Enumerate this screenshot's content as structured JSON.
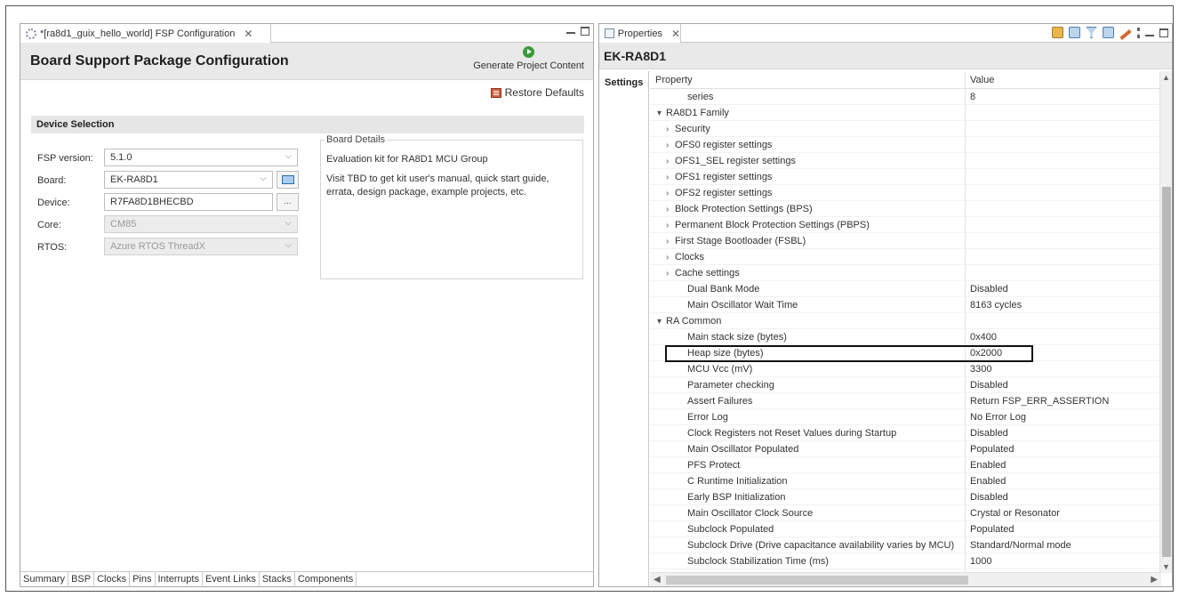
{
  "editor": {
    "tab_title": "*[ra8d1_guix_hello_world] FSP Configuration",
    "tab_close": "✕",
    "header_title": "Board Support Package Configuration",
    "generate_label": "Generate Project Content",
    "restore_label": "Restore Defaults",
    "section_title": "Device Selection",
    "fields": {
      "fsp_version_label": "FSP version:",
      "fsp_version_value": "5.1.0",
      "board_label": "Board:",
      "board_value": "EK-RA8D1",
      "device_label": "Device:",
      "device_value": "R7FA8D1BHECBD",
      "device_browse": "...",
      "core_label": "Core:",
      "core_value": "CM85",
      "rtos_label": "RTOS:",
      "rtos_value": "Azure RTOS ThreadX"
    },
    "board_details": {
      "title": "Board Details",
      "line1": "Evaluation kit for RA8D1 MCU Group",
      "line2": "Visit TBD to get kit user's manual, quick start guide,",
      "line3": "errata, design package, example projects, etc."
    },
    "bottom_tabs": [
      "Summary",
      "BSP",
      "Clocks",
      "Pins",
      "Interrupts",
      "Event Links",
      "Stacks",
      "Components"
    ]
  },
  "properties": {
    "tab_title": "Properties",
    "tab_close": "✕",
    "header_title": "EK-RA8D1",
    "side_tab": "Settings",
    "col_property": "Property",
    "col_value": "Value",
    "rows": [
      {
        "p": "series",
        "v": "8",
        "indent": 2,
        "twisty": ""
      },
      {
        "p": "RA8D1 Family",
        "v": "",
        "indent": 0,
        "twisty": "▾"
      },
      {
        "p": "Security",
        "v": "",
        "indent": 1,
        "twisty": "›"
      },
      {
        "p": "OFS0 register settings",
        "v": "",
        "indent": 1,
        "twisty": "›"
      },
      {
        "p": "OFS1_SEL register settings",
        "v": "",
        "indent": 1,
        "twisty": "›"
      },
      {
        "p": "OFS1 register settings",
        "v": "",
        "indent": 1,
        "twisty": "›"
      },
      {
        "p": "OFS2 register settings",
        "v": "",
        "indent": 1,
        "twisty": "›"
      },
      {
        "p": "Block Protection Settings (BPS)",
        "v": "",
        "indent": 1,
        "twisty": "›"
      },
      {
        "p": "Permanent Block Protection Settings (PBPS)",
        "v": "",
        "indent": 1,
        "twisty": "›"
      },
      {
        "p": "First Stage Bootloader (FSBL)",
        "v": "",
        "indent": 1,
        "twisty": "›"
      },
      {
        "p": "Clocks",
        "v": "",
        "indent": 1,
        "twisty": "›"
      },
      {
        "p": "Cache settings",
        "v": "",
        "indent": 1,
        "twisty": "›"
      },
      {
        "p": "Dual Bank Mode",
        "v": "Disabled",
        "indent": 2,
        "twisty": ""
      },
      {
        "p": "Main Oscillator Wait Time",
        "v": "8163 cycles",
        "indent": 2,
        "twisty": ""
      },
      {
        "p": "RA Common",
        "v": "",
        "indent": 0,
        "twisty": "▾"
      },
      {
        "p": "Main stack size (bytes)",
        "v": "0x400",
        "indent": 2,
        "twisty": ""
      },
      {
        "p": "Heap size (bytes)",
        "v": "0x2000",
        "indent": 2,
        "twisty": ""
      },
      {
        "p": "MCU Vcc (mV)",
        "v": "3300",
        "indent": 2,
        "twisty": ""
      },
      {
        "p": "Parameter checking",
        "v": "Disabled",
        "indent": 2,
        "twisty": ""
      },
      {
        "p": "Assert Failures",
        "v": "Return FSP_ERR_ASSERTION",
        "indent": 2,
        "twisty": ""
      },
      {
        "p": "Error Log",
        "v": "No Error Log",
        "indent": 2,
        "twisty": ""
      },
      {
        "p": "Clock Registers not Reset Values during Startup",
        "v": "Disabled",
        "indent": 2,
        "twisty": ""
      },
      {
        "p": "Main Oscillator Populated",
        "v": "Populated",
        "indent": 2,
        "twisty": ""
      },
      {
        "p": "PFS Protect",
        "v": "Enabled",
        "indent": 2,
        "twisty": ""
      },
      {
        "p": "C Runtime Initialization",
        "v": "Enabled",
        "indent": 2,
        "twisty": ""
      },
      {
        "p": "Early BSP Initialization",
        "v": "Disabled",
        "indent": 2,
        "twisty": ""
      },
      {
        "p": "Main Oscillator Clock Source",
        "v": "Crystal or Resonator",
        "indent": 2,
        "twisty": ""
      },
      {
        "p": "Subclock Populated",
        "v": "Populated",
        "indent": 2,
        "twisty": ""
      },
      {
        "p": "Subclock Drive (Drive capacitance availability varies by MCU)",
        "v": "Standard/Normal mode",
        "indent": 2,
        "twisty": ""
      },
      {
        "p": "Subclock Stabilization Time (ms)",
        "v": "1000",
        "indent": 2,
        "twisty": ""
      }
    ]
  }
}
